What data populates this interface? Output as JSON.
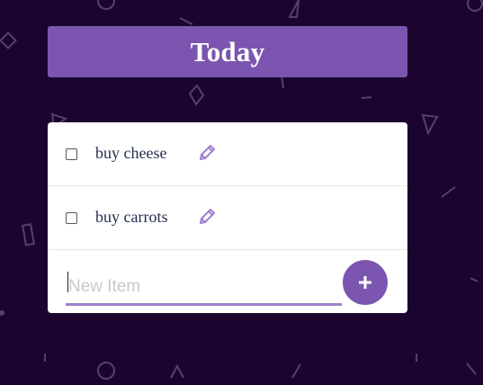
{
  "header": {
    "title": "Today"
  },
  "items": [
    {
      "label": "buy cheese",
      "checked": false,
      "edit_icon": "pencil-icon"
    },
    {
      "label": "buy carrots",
      "checked": false,
      "edit_icon": "pencil-icon"
    }
  ],
  "new_item": {
    "placeholder": "New Item",
    "value": "",
    "add_icon": "plus-icon"
  },
  "colors": {
    "background": "#1b0530",
    "accent": "#7b55b0",
    "card": "#ffffff",
    "icon": "#a27fd3",
    "text": "#1f2d4a"
  }
}
